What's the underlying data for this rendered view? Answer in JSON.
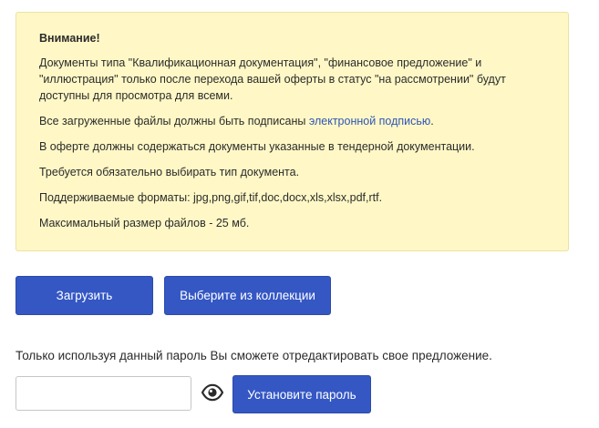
{
  "notice": {
    "title": "Внимание!",
    "paragraph1": "Документы типа \"Квалификационная документация\", \"финансовое предложение\" и \"иллюстрация\" только после перехода вашей оферты в статус \"на рассмотрении\" будут доступны для просмотра для всеми.",
    "paragraph2_prefix": "Все загруженные файлы должны быть подписаны ",
    "paragraph2_link": "электронной подписью",
    "paragraph2_suffix": ".",
    "paragraph3": "В оферте должны содержаться документы указанные в тендерной документации.",
    "paragraph4": "Требуется обязательно выбирать тип документа.",
    "paragraph5": "Поддерживаемые форматы: jpg,png,gif,tif,doc,docx,xls,xlsx,pdf,rtf.",
    "paragraph6": "Максимальный размер файлов - 25 мб."
  },
  "actions": {
    "upload_label": "Загрузить",
    "collection_label": "Выберите из коллекции"
  },
  "password": {
    "hint": "Только используя данный пароль Вы сможете отредактировать свое предложение.",
    "input_value": "",
    "set_label": "Установите пароль",
    "toggle_icon": "eye-icon"
  },
  "colors": {
    "notice_background": "#fff8c6",
    "notice_border": "#ebe2a2",
    "primary_button": "#3457c4",
    "link": "#2f55b5"
  }
}
